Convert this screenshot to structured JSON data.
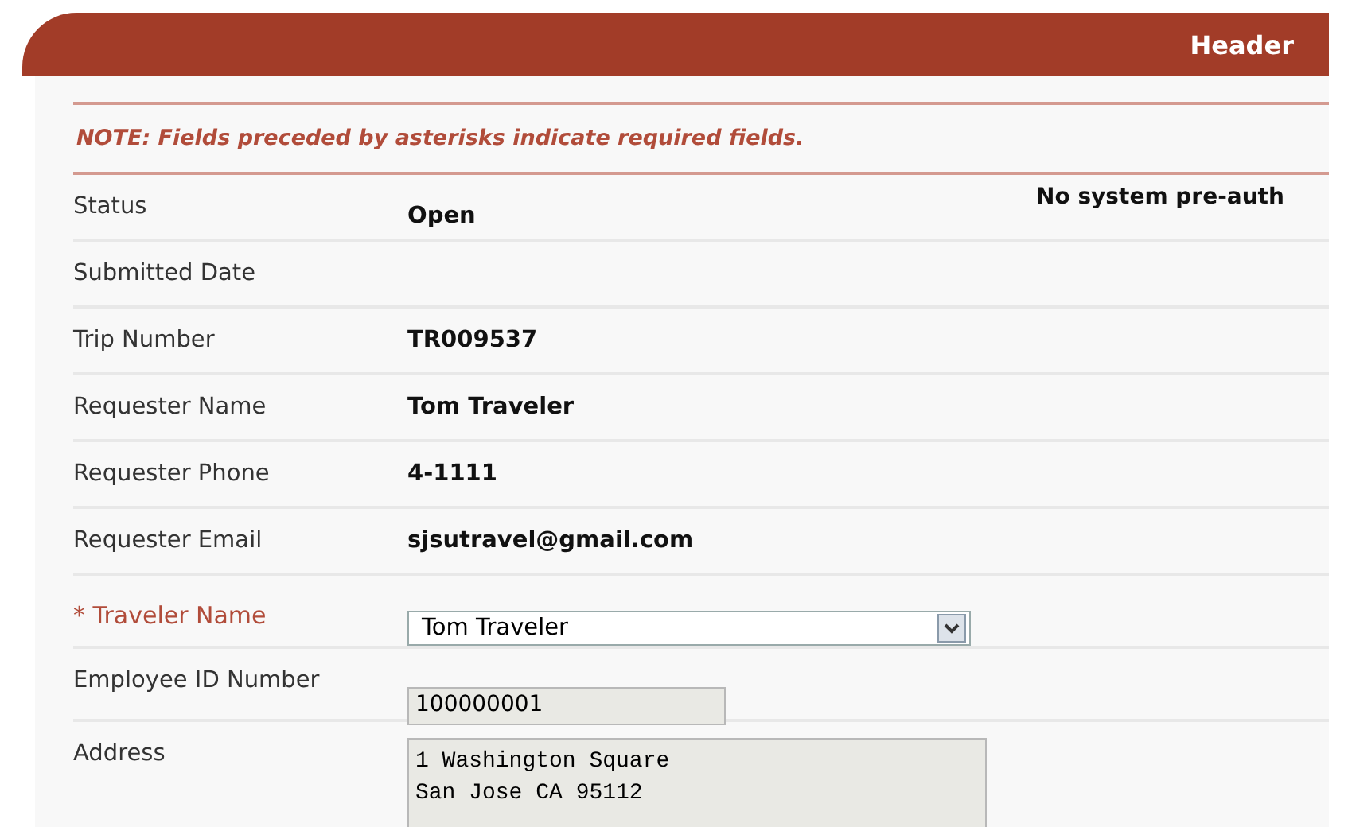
{
  "header": {
    "title": "Header"
  },
  "note": "NOTE: Fields preceded by asterisks indicate required fields.",
  "fields": [
    {
      "kind": "text",
      "label": "Status",
      "value": "Open",
      "required": false,
      "aside": "No system pre-auth"
    },
    {
      "kind": "text",
      "label": "Submitted Date",
      "required": false
    },
    {
      "kind": "text",
      "label": "Trip Number",
      "value": "TR009537",
      "required": false
    },
    {
      "kind": "text",
      "label": "Requester Name",
      "value": "Tom Traveler",
      "required": false
    },
    {
      "kind": "text",
      "label": "Requester Phone",
      "value": "4-1111",
      "required": false
    },
    {
      "kind": "text",
      "label": "Requester Email",
      "value": "sjsutravel@gmail.com",
      "required": false
    },
    {
      "kind": "select",
      "label": "* Traveler Name",
      "value": "Tom Traveler",
      "required": true
    },
    {
      "kind": "readonly",
      "label": "Employee ID Number",
      "value": "100000001",
      "required": false
    },
    {
      "kind": "textarea",
      "label": "Address",
      "lines": [
        "1 Washington Square",
        "San Jose CA 95112"
      ],
      "required": false
    }
  ]
}
